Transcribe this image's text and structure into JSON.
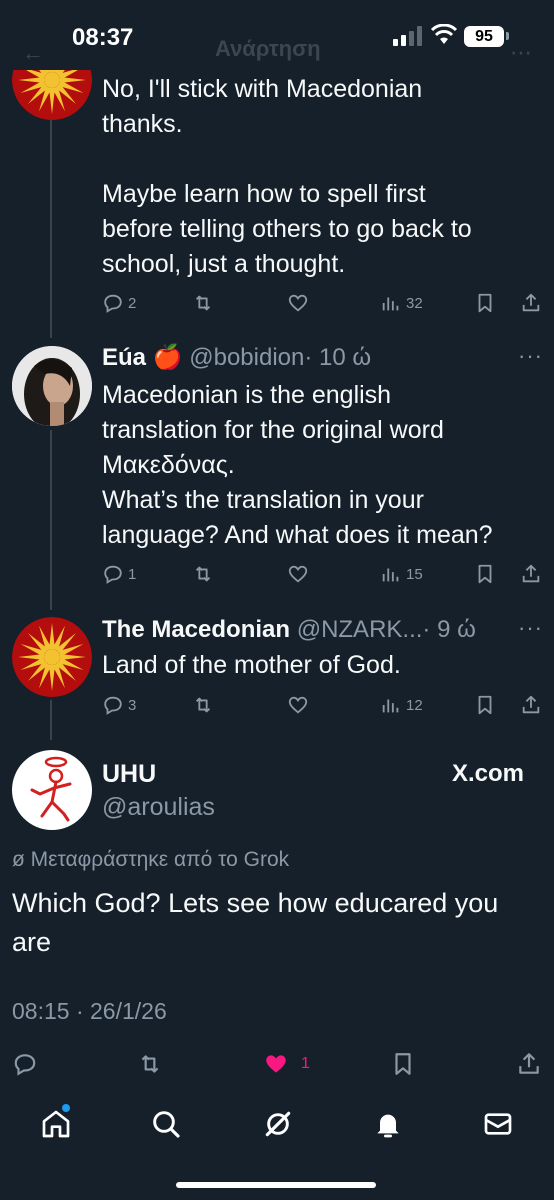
{
  "status_bar": {
    "time": "08:37",
    "battery": "95",
    "ghost_title": "Ανάρτηση"
  },
  "tweets": [
    {
      "lines": [
        "No, I'll stick with Macedonian",
        "thanks.",
        "",
        "Maybe learn how to spell first",
        "before telling others to go back to",
        "school, just a thought."
      ],
      "replies": "2",
      "retweets": "",
      "likes": "",
      "views": "32"
    },
    {
      "name": "Eúa",
      "emoji": "🍎",
      "handle": "@bobidion",
      "time": "· 10 ώ",
      "lines": [
        "Macedonian is the english",
        "translation for the original word",
        "Μακεδόνας.",
        "What’s the translation in your",
        "language? And what does it mean?"
      ],
      "replies": "1",
      "retweets": "",
      "likes": "",
      "views": "15"
    },
    {
      "name": "The Macedonian",
      "handle": "@NZARK...",
      "time": "· 9 ώ",
      "lines": [
        "Land of the mother of God."
      ],
      "replies": "3",
      "retweets": "",
      "likes": "",
      "views": "12"
    }
  ],
  "main_tweet": {
    "name": "UHU",
    "handle": "@aroulias",
    "source": "X.com",
    "translated_label": "Μεταφράστηκε από το Grok",
    "lines": [
      "Which God? Lets see how educared you",
      "are"
    ],
    "timestamp": "08:15 · 26/1/26",
    "likes": "1"
  },
  "more_label": "···",
  "colors": {
    "background": "#15202b",
    "muted": "#8b98a5",
    "like": "#f91880",
    "accent": "#1d9bf0"
  },
  "icons": [
    "reply-icon",
    "retweet-icon",
    "like-icon",
    "views-icon",
    "bookmark-icon",
    "share-icon",
    "home-icon",
    "search-icon",
    "grok-icon",
    "notifications-icon",
    "messages-icon"
  ]
}
